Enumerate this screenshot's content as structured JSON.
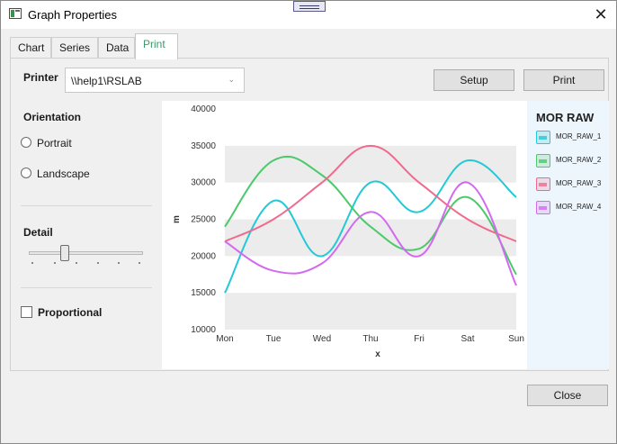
{
  "window": {
    "title": "Graph Properties"
  },
  "tabs": [
    {
      "label": "Chart"
    },
    {
      "label": "Series"
    },
    {
      "label": "Data"
    },
    {
      "label": "Print"
    }
  ],
  "print": {
    "printer_label": "Printer",
    "printer_value": "\\\\help1\\RSLAB",
    "setup_label": "Setup",
    "print_label": "Print",
    "orientation_label": "Orientation",
    "portrait_label": "Portrait",
    "landscape_label": "Landscape",
    "detail_label": "Detail",
    "detail_level_fraction": 0.4,
    "proportional_label": "Proportional"
  },
  "footer": {
    "close_label": "Close"
  },
  "icons": [
    "app-icon",
    "close-icon",
    "chevron-down-icon"
  ],
  "chart_data": {
    "type": "line",
    "title": "",
    "legend_title": "MOR RAW",
    "legend_position": "right",
    "xlabel": "x",
    "ylabel": "m",
    "categories": [
      "Mon",
      "Tue",
      "Wed",
      "Thu",
      "Fri",
      "Sat",
      "Sun"
    ],
    "yticks": [
      "10000",
      "15000",
      "20000",
      "25000",
      "30000",
      "35000",
      "40000"
    ],
    "ylim": [
      10000,
      40000
    ],
    "grid_bands": true,
    "series": [
      {
        "name": "MOR_RAW_1",
        "color": "#22c9d6",
        "values": [
          15000,
          27500,
          20000,
          30000,
          26000,
          33000,
          28000
        ]
      },
      {
        "name": "MOR_RAW_2",
        "color": "#4cc96a",
        "values": [
          24000,
          33000,
          31000,
          24000,
          21000,
          28000,
          17500
        ]
      },
      {
        "name": "MOR_RAW_3",
        "color": "#f06a8e",
        "values": [
          22000,
          25000,
          30000,
          35000,
          30000,
          25000,
          22000
        ]
      },
      {
        "name": "MOR_RAW_4",
        "color": "#d26af0",
        "values": [
          22000,
          18000,
          19000,
          26000,
          20000,
          30000,
          16000
        ]
      }
    ]
  }
}
